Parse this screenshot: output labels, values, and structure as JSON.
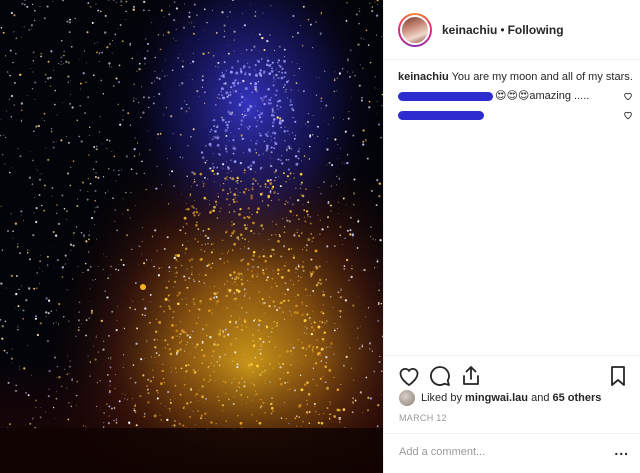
{
  "header": {
    "username": "keinachiu",
    "separator": "•",
    "follow_status": "Following"
  },
  "caption": {
    "username": "keinachiu",
    "text": "You are my moon and all of my stars."
  },
  "comments": [
    {
      "text": "😍😍😍amazing ....."
    },
    {
      "text": ""
    }
  ],
  "likes": {
    "prefix": "Liked by",
    "user": "mingwai.lau",
    "conjunction": "and",
    "others": "65 others"
  },
  "date": "MARCH 12",
  "add_comment": {
    "placeholder": "Add a comment...",
    "more": "..."
  },
  "icons": {
    "like": "heart-icon",
    "comment": "comment-icon",
    "share": "share-icon",
    "save": "bookmark-icon",
    "comment_like": "heart-icon"
  },
  "colors": {
    "scribble": "#2d2ccf",
    "text": "#262626",
    "muted": "#999999"
  }
}
